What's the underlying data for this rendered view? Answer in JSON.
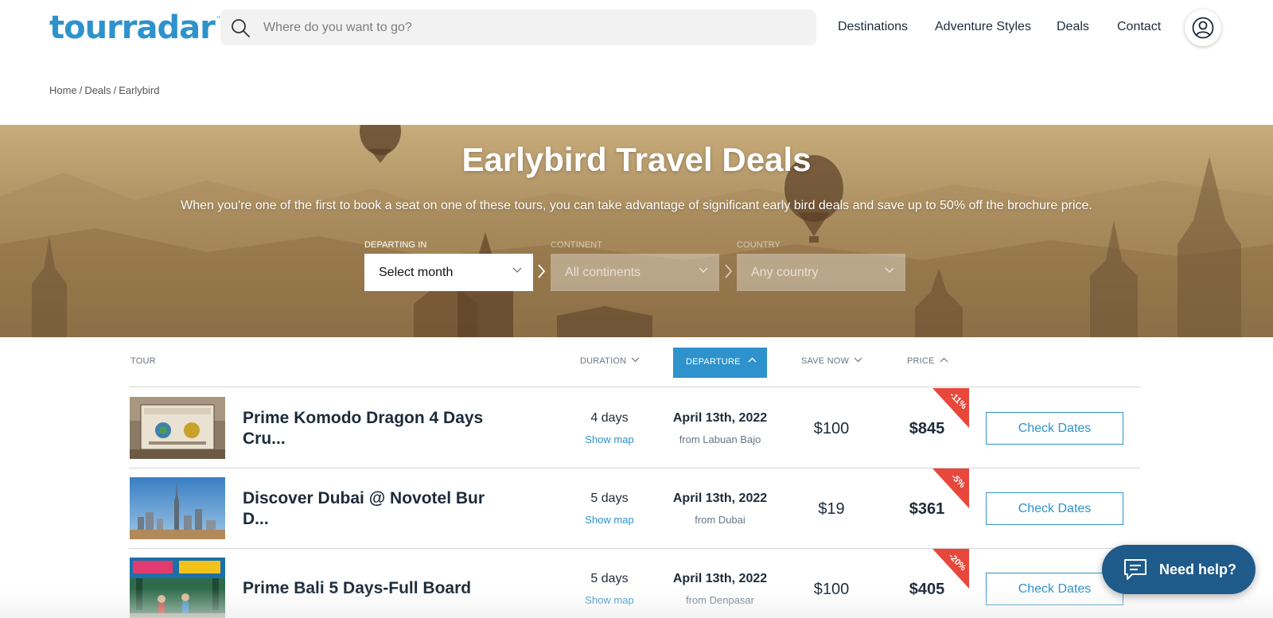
{
  "header": {
    "logo": "tourradar",
    "logo_tm": "™",
    "search_placeholder": "Where do you want to go?",
    "nav": [
      "Destinations",
      "Adventure Styles",
      "Deals",
      "Contact"
    ]
  },
  "breadcrumb": [
    "Home",
    "Deals",
    "Earlybird"
  ],
  "hero": {
    "title": "Earlybird Travel Deals",
    "subtitle": "When you're one of the first to book a seat on one of these tours, you can take advantage of significant early bird deals and save up to 50% off the brochure price.",
    "filters": [
      {
        "label": "DEPARTING IN",
        "value": "Select month",
        "enabled": true
      },
      {
        "label": "CONTINENT",
        "value": "All continents",
        "enabled": false
      },
      {
        "label": "COUNTRY",
        "value": "Any country",
        "enabled": false
      }
    ]
  },
  "table": {
    "headers": {
      "tour": "TOUR",
      "duration": "DURATION",
      "departure": "DEPARTURE",
      "save_now": "SAVE NOW",
      "price": "PRICE"
    },
    "rows": [
      {
        "name": "Prime Komodo Dragon 4 Days Cru...",
        "duration": "4 days",
        "show_map": "Show map",
        "departure_date": "April 13th, 2022",
        "departure_from": "from Labuan Bajo",
        "save": "$100",
        "price": "$845",
        "discount": "-11%",
        "button": "Check Dates"
      },
      {
        "name": "Discover Dubai @ Novotel Bur D...",
        "duration": "5 days",
        "show_map": "Show map",
        "departure_date": "April 13th, 2022",
        "departure_from": "from Dubai",
        "save": "$19",
        "price": "$361",
        "discount": "-5%",
        "button": "Check Dates"
      },
      {
        "name": "Prime Bali 5 Days-Full Board",
        "duration": "5 days",
        "show_map": "Show map",
        "departure_date": "April 13th, 2022",
        "departure_from": "from Denpasar",
        "save": "$100",
        "price": "$405",
        "discount": "-20%",
        "button": "Check Dates"
      }
    ]
  },
  "help": {
    "label": "Need help?"
  },
  "colors": {
    "brand": "#2e92cc",
    "ribbon": "#e8473b",
    "help": "#1e5a8a"
  }
}
